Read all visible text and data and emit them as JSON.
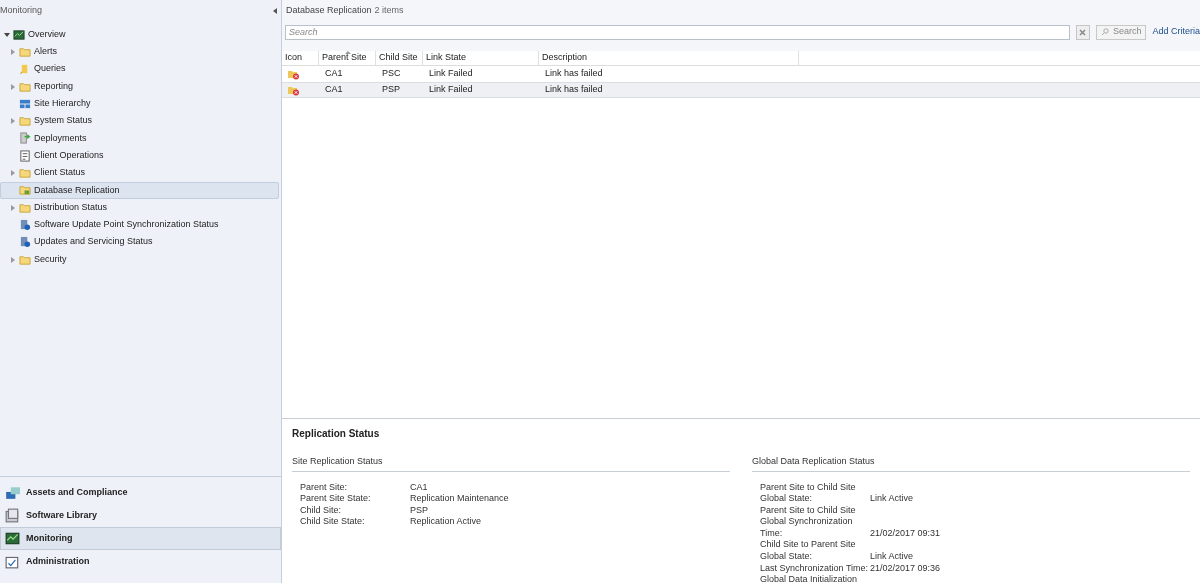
{
  "navigation": {
    "title": "Monitoring",
    "tree": [
      {
        "label": "Overview",
        "kind": "overview",
        "expanded": true,
        "selected": false,
        "children": [
          {
            "label": "Alerts",
            "kind": "folder",
            "expanded": false,
            "selected": false
          },
          {
            "label": "Queries",
            "kind": "query",
            "selected": false
          },
          {
            "label": "Reporting",
            "kind": "folder",
            "expanded": false,
            "selected": false
          },
          {
            "label": "Site Hierarchy",
            "kind": "hierarchy",
            "selected": false
          },
          {
            "label": "System Status",
            "kind": "folder",
            "expanded": false,
            "selected": false
          },
          {
            "label": "Deployments",
            "kind": "deploy",
            "selected": false
          },
          {
            "label": "Client Operations",
            "kind": "clientops",
            "selected": false
          },
          {
            "label": "Client Status",
            "kind": "folder",
            "expanded": false,
            "selected": false
          },
          {
            "label": "Database Replication",
            "kind": "dbfolder",
            "selected": true
          },
          {
            "label": "Distribution Status",
            "kind": "folder",
            "expanded": false,
            "selected": false
          },
          {
            "label": "Software Update Point Synchronization Status",
            "kind": "update",
            "selected": false
          },
          {
            "label": "Updates and Servicing Status",
            "kind": "update",
            "selected": false
          },
          {
            "label": "Security",
            "kind": "folder",
            "expanded": false,
            "selected": false
          }
        ]
      }
    ],
    "workspaces": [
      {
        "label": "Assets and Compliance",
        "kind": "assets",
        "selected": false
      },
      {
        "label": "Software Library",
        "kind": "library",
        "selected": false
      },
      {
        "label": "Monitoring",
        "kind": "monitor",
        "selected": true
      },
      {
        "label": "Administration",
        "kind": "admin",
        "selected": false
      }
    ]
  },
  "list": {
    "title": "Database Replication",
    "count": "2 items",
    "search": {
      "placeholder": "Search"
    },
    "search_button": "Search",
    "add_criteria": "Add Criteria",
    "icon_column": {
      "label": "Icon",
      "sorted": false
    },
    "columns": [
      {
        "label": "Parent Site",
        "sorted": true
      },
      {
        "label": "Child Site",
        "sorted": false
      },
      {
        "label": "Link State",
        "sorted": false
      },
      {
        "label": "Description",
        "sorted": false
      }
    ],
    "rows": [
      {
        "cells": [
          "CA1",
          "PSC",
          "Link Failed",
          "Link has failed"
        ],
        "selected": false
      },
      {
        "cells": [
          "CA1",
          "PSP",
          "Link Failed",
          "Link has failed"
        ],
        "selected": true
      }
    ]
  },
  "details": {
    "title": "Replication Status",
    "sections": [
      {
        "title": "Site Replication Status",
        "fields": [
          {
            "label": "Parent Site:",
            "value": "CA1"
          },
          {
            "label": "Parent Site State:",
            "value": "Replication Maintenance"
          },
          {
            "label": "Child Site:",
            "value": "PSP"
          },
          {
            "label": "Child Site State:",
            "value": "Replication Active"
          }
        ]
      },
      {
        "title": "Global Data Replication Status",
        "fields": [
          {
            "label": "Parent Site to Child Site Global State:",
            "value": "Link Active"
          },
          {
            "label": "Parent Site to Child Site Global Synchronization Time:",
            "value": "21/02/2017 09:31"
          },
          {
            "label": "Child Site to Parent Site Global State:",
            "value": "Link Active"
          },
          {
            "label": "Last Synchronization Time:",
            "value": "21/02/2017 09:36"
          },
          {
            "label": "Global Data Initialization"
          }
        ]
      }
    ]
  }
}
